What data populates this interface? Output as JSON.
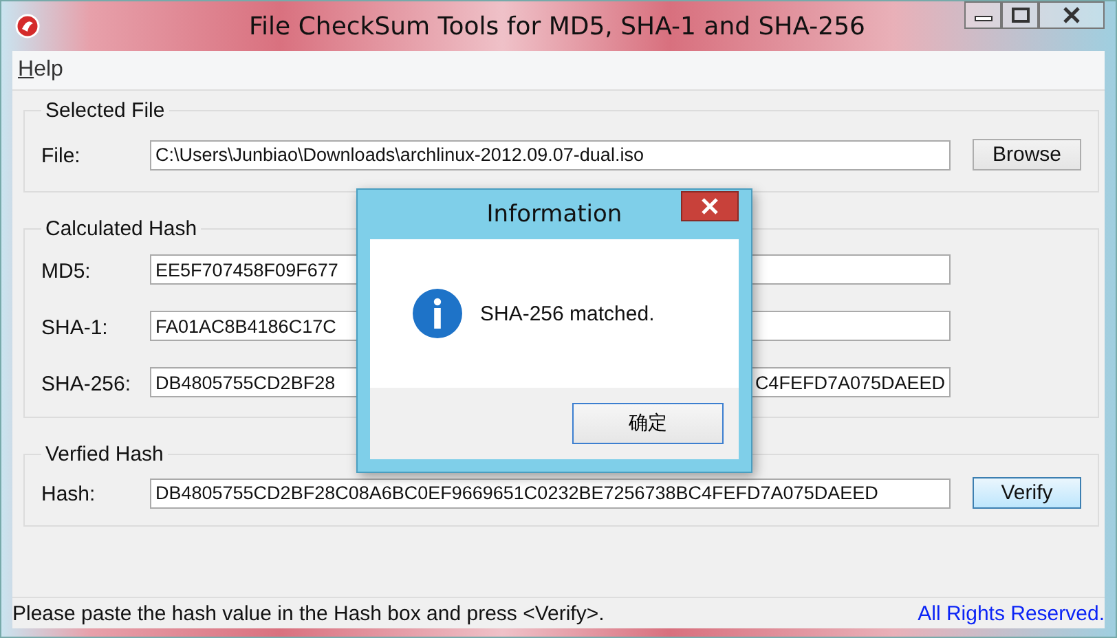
{
  "window": {
    "title": "File CheckSum Tools for MD5, SHA-1 and SHA-256"
  },
  "menu": [
    {
      "label": "Help"
    }
  ],
  "selected_file": {
    "title": "Selected File",
    "label": "File:",
    "value": "C:\\Users\\Junbiao\\Downloads\\archlinux-2012.09.07-dual.iso",
    "button": {
      "label": "Browse",
      "focused": false
    }
  },
  "calculated_hash": {
    "title": "Calculated Hash",
    "rows": [
      {
        "label": "MD5:",
        "kind": "plain",
        "value": "EE5F707458F09F677"
      },
      {
        "label": "SHA-1:",
        "kind": "plain",
        "value": "FA01AC8B4186C17C"
      },
      {
        "label": "SHA-256:",
        "kind": "split",
        "value_left": "DB4805755CD2BF28",
        "value_right": "C4FEFD7A075DAEED"
      }
    ]
  },
  "verified_hash": {
    "title": "Verfied Hash",
    "label": "Hash:",
    "value": "DB4805755CD2BF28C08A6BC0EF9669651C0232BE7256738BC4FEFD7A075DAEED",
    "button": {
      "label": "Verify",
      "focused": true
    }
  },
  "status_bar": {
    "message": "Please paste the hash value in the Hash box and press <Verify>.",
    "rights": "All Rights Reserved."
  },
  "dialog": {
    "title": "Information",
    "message": "SHA-256 matched.",
    "button": "确定"
  }
}
